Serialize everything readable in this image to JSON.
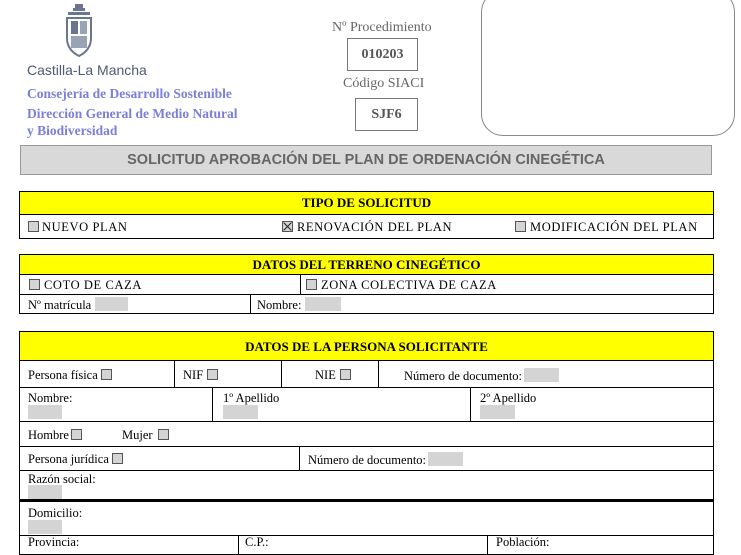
{
  "header": {
    "org_name": "Castilla-La Mancha",
    "consejeria": "Consejería de Desarrollo Sostenible",
    "direccion_line1": "Dirección General de Medio Natural",
    "direccion_line2": "y Biodiversidad",
    "procedimiento_label": "Nº Procedimiento",
    "procedimiento_value": "010203",
    "siaci_label": "Código SIACI",
    "siaci_value": "SJF6"
  },
  "title": "SOLICITUD APROBACIÓN DEL PLAN DE ORDENACIÓN CINEGÉTICA",
  "tipo_solicitud": {
    "header": "TIPO DE SOLICITUD",
    "options": [
      {
        "label": "NUEVO PLAN",
        "checked": false
      },
      {
        "label": "RENOVACIÓN DEL PLAN",
        "checked": true
      },
      {
        "label": "MODIFICACIÓN DEL PLAN",
        "checked": false
      }
    ]
  },
  "terreno": {
    "header": "DATOS DEL TERRENO CINEGÉTICO",
    "coto": "COTO DE CAZA",
    "zona": "ZONA COLECTIVA DE CAZA",
    "matricula": "Nº matrícula",
    "nombre": "Nombre:"
  },
  "solicitante": {
    "header": "DATOS DE LA PERSONA SOLICITANTE",
    "persona_fisica": "Persona física",
    "nif": "NIF",
    "nie": "NIE",
    "numero_documento": "Número de documento:",
    "nombre": "Nombre:",
    "apellido1": "1º Apellido",
    "apellido2": "2º Apellido",
    "hombre": "Hombre",
    "mujer": "Mujer",
    "persona_juridica": "Persona jurídica",
    "numero_documento2": "Número de documento:",
    "razon_social": "Razón social:",
    "domicilio": "Domicilio:",
    "provincia": "Provincia:",
    "cp": "C.P.:",
    "poblacion": "Población:"
  }
}
